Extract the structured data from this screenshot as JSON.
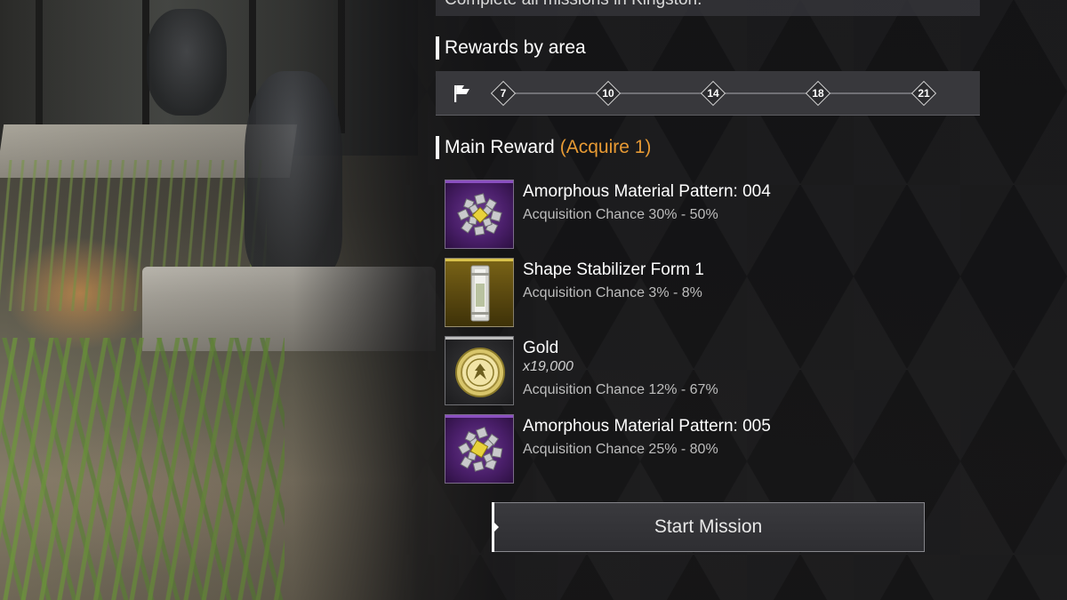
{
  "mission": {
    "description": "Complete all missions in Kingston."
  },
  "rewards_by_area": {
    "title": "Rewards by area",
    "flag_icon": "flag-icon",
    "levels": [
      "7",
      "10",
      "14",
      "18",
      "21"
    ]
  },
  "main_reward": {
    "title": "Main Reward",
    "acquire_note": "(Acquire 1)",
    "items": [
      {
        "name": "Amorphous Material Pattern: 004",
        "chance": "Acquisition Chance 30% - 50%",
        "icon": "amorphous-material-icon",
        "rarity_color": "#8a4fc0"
      },
      {
        "name": "Shape Stabilizer Form 1",
        "chance": "Acquisition Chance 3% - 8%",
        "icon": "shape-stabilizer-icon",
        "rarity_color": "#d9c24a"
      },
      {
        "name": "Gold",
        "quantity": "x19,000",
        "chance": "Acquisition Chance 12% - 67%",
        "icon": "gold-coin-icon",
        "rarity_color": "#bdbdbd"
      },
      {
        "name": "Amorphous Material Pattern: 005",
        "chance": "Acquisition Chance 25% - 80%",
        "icon": "amorphous-material-icon",
        "rarity_color": "#8a4fc0"
      }
    ]
  },
  "actions": {
    "start_label": "Start Mission"
  },
  "colors": {
    "accent": "#e79a34",
    "panel": "#141416"
  }
}
